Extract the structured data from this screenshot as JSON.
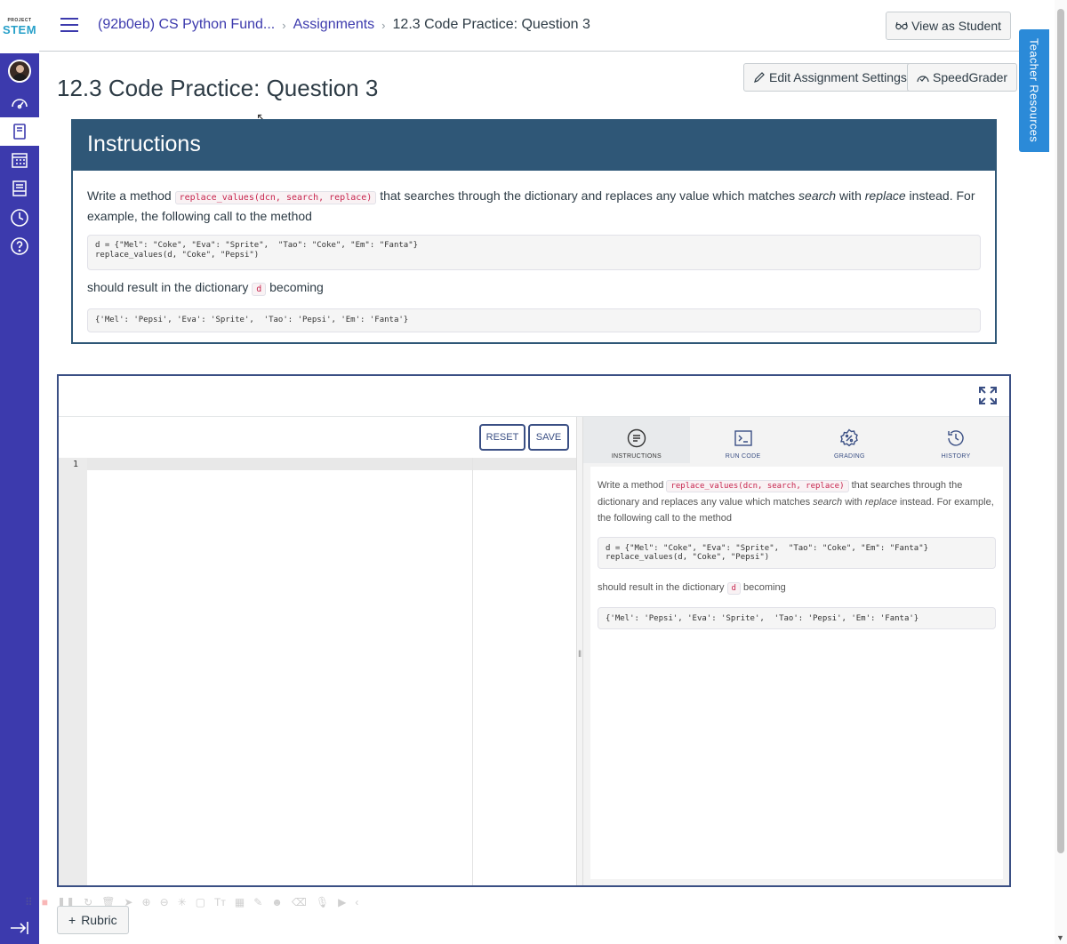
{
  "logo": {
    "line1": "PROJECT",
    "line2": "STEM"
  },
  "breadcrumbs": {
    "course": "(92b0eb) CS Python Fund...",
    "section": "Assignments",
    "current": "12.3 Code Practice: Question 3"
  },
  "header": {
    "view_as_student": "View as Student"
  },
  "teacher_resources": "Teacher Resources",
  "page": {
    "title": "12.3 Code Practice: Question 3",
    "edit_settings": "Edit Assignment Settings",
    "speedgrader": "SpeedGrader"
  },
  "instructions": {
    "heading": "Instructions",
    "p1_pre": "Write a method ",
    "p1_code": "replace_values(dcn, search, replace)",
    "p1_mid": " that searches through the dictionary and replaces any value which matches ",
    "p1_em1": "search",
    "p1_with": " with ",
    "p1_em2": "replace",
    "p1_post": " instead. For example, the following call to the method",
    "code1": "d = {\"Mel\": \"Coke\", \"Eva\": \"Sprite\",  \"Tao\": \"Coke\", \"Em\": \"Fanta\"}\nreplace_values(d, \"Coke\", \"Pepsi\")",
    "p2_pre": "should result in the dictionary ",
    "p2_code": "d",
    "p2_post": " becoming",
    "code2": "{'Mel': 'Pepsi', 'Eva': 'Sprite',  'Tao': 'Pepsi', 'Em': 'Fanta'}"
  },
  "ide": {
    "reset": "RESET",
    "save": "SAVE",
    "line_number": "1",
    "tabs": [
      {
        "label": "INSTRUCTIONS"
      },
      {
        "label": "RUN CODE"
      },
      {
        "label": "GRADING"
      },
      {
        "label": "HISTORY"
      }
    ]
  },
  "rubric": "Rubric",
  "colors": {
    "nav": "#3c3aad",
    "instructions_header": "#2f5777",
    "ide_border": "#3a4f84",
    "teacher_tab": "#2b8ad8"
  },
  "icons": [
    "hamburger-icon",
    "account-avatar",
    "dashboard-icon",
    "courses-icon",
    "calendar-icon",
    "inbox-icon",
    "history-icon",
    "help-icon",
    "glasses-icon",
    "pencil-icon",
    "speedgrader-icon",
    "expand-icon",
    "collapse-nav-icon"
  ]
}
